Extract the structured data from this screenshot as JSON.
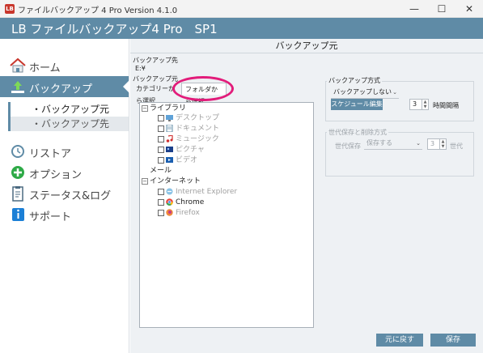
{
  "window": {
    "title": "ファイルバックアップ 4 Pro Version 4.1.0",
    "icon_label": "LB",
    "minimize": "—",
    "maximize": "☐",
    "close": "✕"
  },
  "header": {
    "app_title": "LB ファイルバックアップ4 Pro　SP1"
  },
  "sidebar": {
    "items": [
      {
        "label": "ホーム",
        "icon": "home-icon",
        "active": false
      },
      {
        "label": "バックアップ",
        "icon": "backup-upload-icon",
        "active": true
      },
      {
        "label": "リストア",
        "icon": "restore-clock-icon",
        "active": false
      },
      {
        "label": "オプション",
        "icon": "options-plus-icon",
        "active": false
      },
      {
        "label": "ステータス&ログ",
        "icon": "status-clipboard-icon",
        "active": false
      },
      {
        "label": "サポート",
        "icon": "support-info-icon",
        "active": false
      }
    ],
    "sub_items": [
      {
        "label": "・バックアップ元",
        "selected": true
      },
      {
        "label": "・バックアップ先",
        "selected": false
      }
    ]
  },
  "main": {
    "section_title": "バックアップ元",
    "dest_label": "バックアップ先",
    "dest_value": "E:¥",
    "source_label": "バックアップ元",
    "tabs": [
      {
        "label": "カテゴリーから選択",
        "active": false
      },
      {
        "label": "フォルダから選択",
        "active": true
      }
    ],
    "tree": {
      "library_label": "ライブラリ",
      "library_children": [
        {
          "label": "デスクトップ",
          "icon": "desktop-icon"
        },
        {
          "label": "ドキュメント",
          "icon": "document-icon"
        },
        {
          "label": "ミュージック",
          "icon": "music-icon"
        },
        {
          "label": "ピクチャ",
          "icon": "picture-icon"
        },
        {
          "label": "ビデオ",
          "icon": "video-icon"
        }
      ],
      "mail_label": "メール",
      "internet_label": "インターネット",
      "internet_children": [
        {
          "label": "Internet Explorer",
          "icon": "ie-icon",
          "enabled": false
        },
        {
          "label": "Chrome",
          "icon": "chrome-icon",
          "enabled": true
        },
        {
          "label": "Firefox",
          "icon": "firefox-icon",
          "enabled": false
        }
      ]
    },
    "backup_method": {
      "title": "バックアップ方式",
      "selected": "バックアップしない",
      "schedule_button": "スケジュール編集",
      "interval_value": "3",
      "interval_unit": "時間間隔"
    },
    "generation": {
      "title": "世代保存と削除方式",
      "label": "世代保存",
      "selected": "保存する",
      "count_value": "3",
      "count_unit": "世代"
    },
    "buttons": {
      "revert": "元に戻す",
      "save": "保存"
    }
  },
  "colors": {
    "accent": "#5f8ba6",
    "highlight": "#e21c7a",
    "panel_bg": "#eef1f4"
  }
}
